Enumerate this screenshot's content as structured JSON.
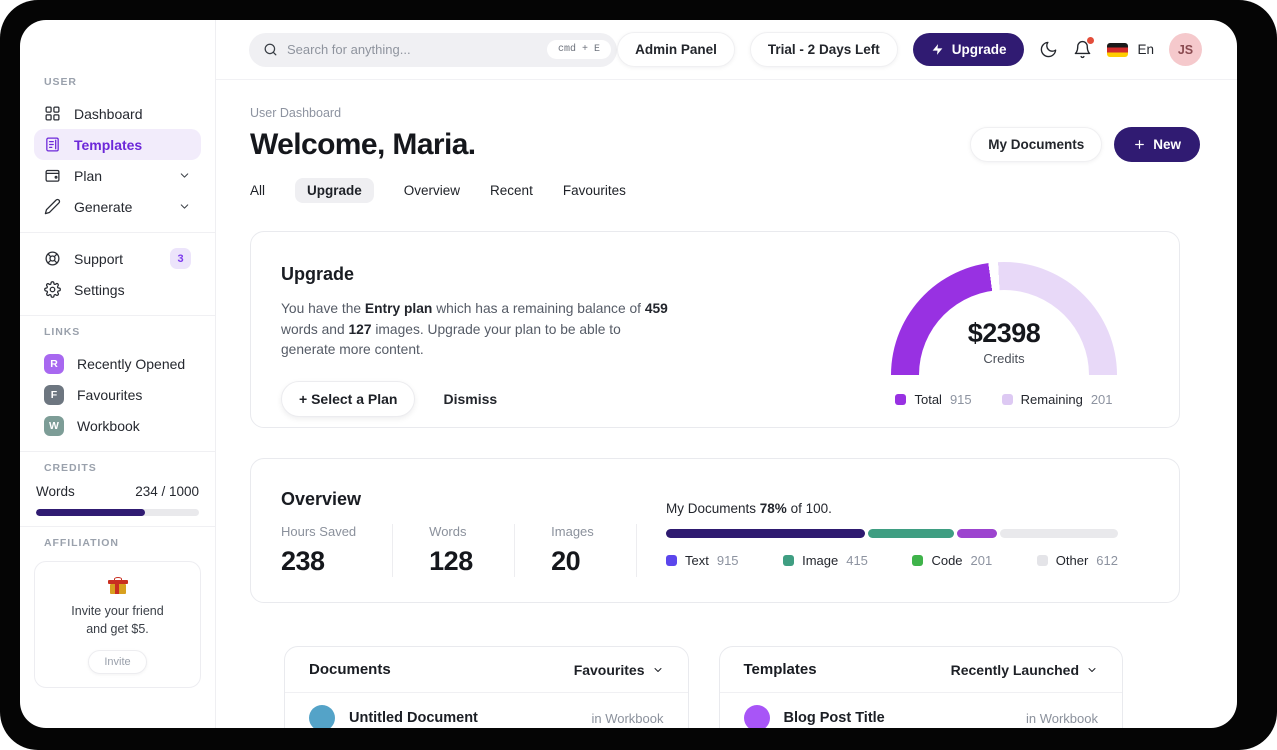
{
  "topbar": {
    "search_placeholder": "Search for anything...",
    "search_shortcut": "cmd + E",
    "admin_panel_label": "Admin Panel",
    "trial_label": "Trial - 2 Days Left",
    "upgrade_label": "Upgrade",
    "language": "En",
    "avatar_initials": "JS"
  },
  "sidebar": {
    "user_label": "USER",
    "items": [
      {
        "label": "Dashboard"
      },
      {
        "label": "Templates",
        "active": true
      },
      {
        "label": "Plan",
        "expandable": true
      },
      {
        "label": "Generate",
        "expandable": true
      }
    ],
    "support": {
      "label": "Support",
      "badge": "3"
    },
    "settings_label": "Settings",
    "links_label": "LINKS",
    "links": [
      {
        "initial": "R",
        "label": "Recently Opened",
        "color": "#a868f0"
      },
      {
        "initial": "F",
        "label": "Favourites",
        "color": "#6d7680"
      },
      {
        "initial": "W",
        "label": "Workbook",
        "color": "#7d9d97"
      }
    ],
    "credits_label": "CREDITS",
    "credits": {
      "label": "Words",
      "value": "234 / 1000",
      "bar_color": "#301b72"
    },
    "affiliation_label": "AFFILIATION",
    "affiliation": {
      "line1": "Invite your friend",
      "line2": "and get $5.",
      "button_label": "Invite"
    }
  },
  "header": {
    "breadcrumb": "User Dashboard",
    "title": "Welcome, Maria.",
    "my_documents_label": "My Documents",
    "new_label": "New",
    "tabs": [
      {
        "label": "All"
      },
      {
        "label": "Upgrade",
        "active": true
      },
      {
        "label": "Overview"
      },
      {
        "label": "Recent"
      },
      {
        "label": "Favourites"
      }
    ]
  },
  "upgrade_card": {
    "title": "Upgrade",
    "p1": "You have the ",
    "b1": "Entry plan",
    "p2": " which has a remaining balance of ",
    "b2": "459",
    "p3": " words and ",
    "b3": "127",
    "p4": " images. Upgrade your plan to be able to generate more content.",
    "select_plan_label": "Select a Plan",
    "dismiss_label": "Dismiss",
    "gauge": {
      "type": "gauge",
      "amount": "$2398",
      "caption": "Credits",
      "total": {
        "label": "Total",
        "value": "915",
        "color": "#9831e2"
      },
      "remaining": {
        "label": "Remaining",
        "value": "201",
        "color": "#e8d9f8"
      },
      "filled_fraction": 0.46
    }
  },
  "overview_card": {
    "title": "Overview",
    "stats": [
      {
        "label": "Hours Saved",
        "value": "238"
      },
      {
        "label": "Words",
        "value": "128"
      },
      {
        "label": "Images",
        "value": "20"
      }
    ],
    "progress": {
      "type": "stacked-bar",
      "prefix": "My Documents ",
      "percent": "78%",
      "suffix": " of 100.",
      "segments": [
        {
          "label": "Text",
          "value": "915",
          "bar_color": "#2e1a70",
          "legend_color": "#5b46ec",
          "width_pct": 44
        },
        {
          "label": "Image",
          "value": "415",
          "bar_color": "#3f9e82",
          "legend_color": "#3f9e82",
          "width_pct": 19
        },
        {
          "label": "Code",
          "value": "201",
          "bar_color": "#9c44cf",
          "legend_color": "#3fb34a",
          "width_pct": 9
        },
        {
          "label": "Other",
          "value": "612",
          "bar_color": "#e9e9ec",
          "legend_color": "#e4e4e8",
          "width_pct": 28
        }
      ]
    }
  },
  "panels": {
    "documents": {
      "title": "Documents",
      "filter": "Favourites",
      "rows": [
        {
          "name": "Untitled Document",
          "location": "in Workbook",
          "avatar_color": "#54a3c8"
        }
      ]
    },
    "templates": {
      "title": "Templates",
      "filter": "Recently Launched",
      "rows": [
        {
          "name": "Blog Post Title",
          "location": "in Workbook",
          "avatar_color": "#a855f7"
        }
      ]
    }
  }
}
